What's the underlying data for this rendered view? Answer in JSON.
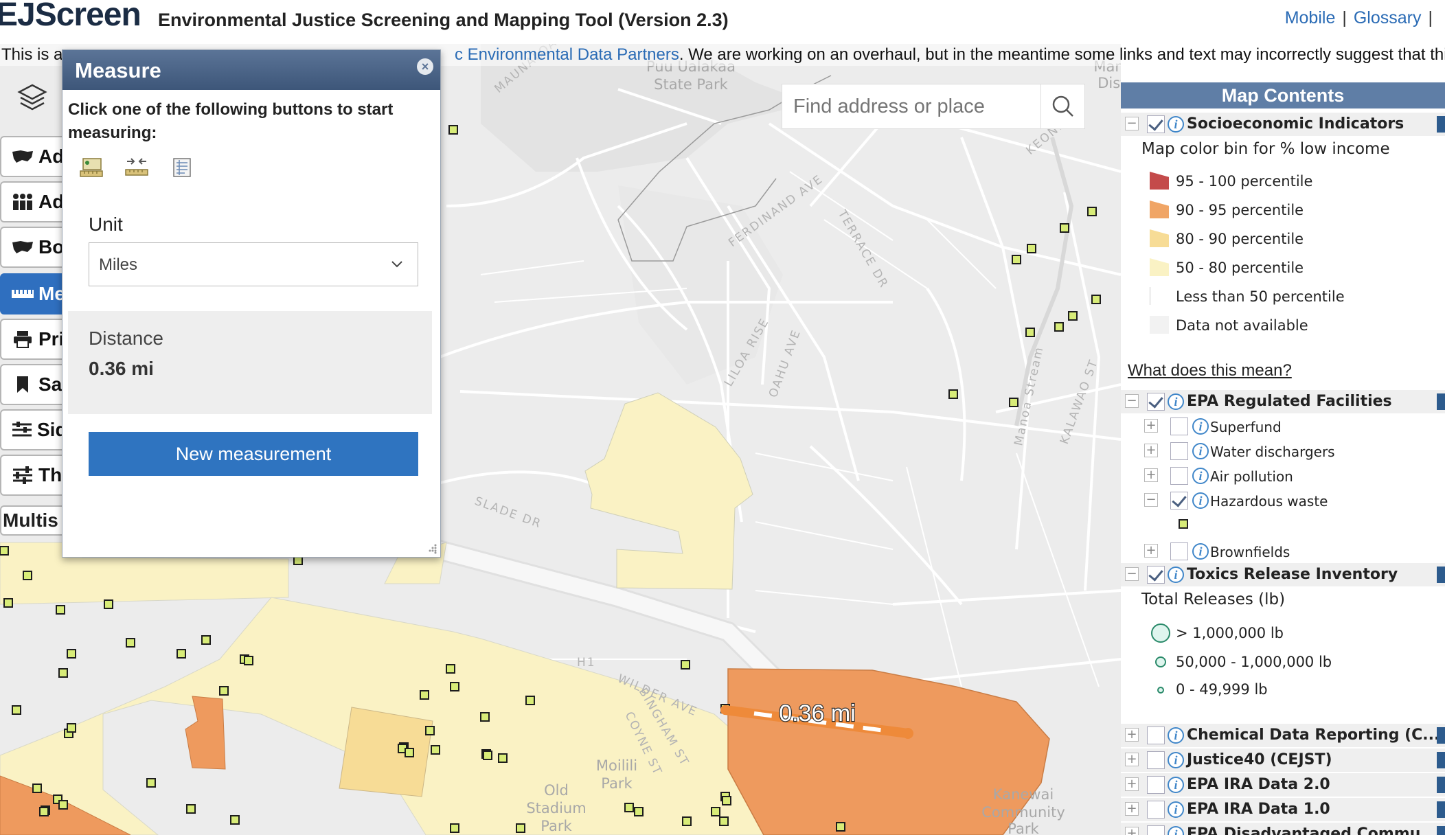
{
  "header": {
    "logo": "EJScreen",
    "title": "Environmental Justice Screening and Mapping Tool (Version 2.3)",
    "links": [
      "Mobile",
      "Glossary"
    ]
  },
  "banner": {
    "lead": "This is a",
    "link": "c Environmental Data Partners",
    "rest": ". We are working on an overhaul, but in the meantime some links and text may incorrectly suggest that this"
  },
  "search": {
    "placeholder": "Find address or place"
  },
  "toolbar": {
    "items": [
      "Ad",
      "Ad",
      "Bo",
      "Me",
      "Pri",
      "Sa",
      "Sid",
      "Th"
    ],
    "multi": "Multis"
  },
  "measure": {
    "title": "Measure",
    "close": "×",
    "instruction": "Click one of the following buttons to start measuring:",
    "tools": [
      "area-tool-icon",
      "distance-tool-icon",
      "location-tool-icon"
    ],
    "unit_label": "Unit",
    "unit_value": "Miles",
    "distance_label": "Distance",
    "distance_value": "0.36 mi",
    "new_button": "New measurement"
  },
  "map": {
    "measure_label": "0.36 mi",
    "road_labels": [
      "MAUNALOA",
      "KEONI",
      "FERDINAND AVE",
      "TERRACE DR",
      "LILOA RISE",
      "OAHU AVE",
      "SLADE DR",
      "Manoa Stream",
      "KALAWAO ST",
      "WILDER AVE",
      "BINGHAM ST",
      "COYNE ST",
      "H1"
    ],
    "place_labels": [
      "Puu Ualakaa",
      "State Park",
      "Manoa Valley",
      "District Park",
      "Moilili",
      "Park",
      "Old",
      "Stadium",
      "Park",
      "Kanewai",
      "Community",
      "Park"
    ]
  },
  "map_contents": {
    "title": "Map Contents",
    "socio": {
      "label": "Socioeconomic Indicators",
      "caption": "Map color bin for % low income",
      "bins": [
        {
          "label": "95 - 100 percentile",
          "color": "#c44b4b"
        },
        {
          "label": "90 - 95 percentile",
          "color": "#f0a566"
        },
        {
          "label": "80 - 90 percentile",
          "color": "#f7dc96"
        },
        {
          "label": "50 - 80 percentile",
          "color": "#faf2c4"
        },
        {
          "label": "Less than 50 percentile",
          "color": "#ffffff"
        },
        {
          "label": "Data not available",
          "color": "#f2f2f2"
        }
      ],
      "what": "What does this mean?"
    },
    "epa": {
      "label": "EPA Regulated Facilities",
      "items": [
        "Superfund",
        "Water dischargers",
        "Air pollution",
        "Hazardous waste",
        "Brownfields"
      ]
    },
    "tri": {
      "label": "Toxics Release Inventory",
      "caption": "Total Releases (lb)",
      "bins": [
        "> 1,000,000 lb",
        "50,000 - 1,000,000 lb",
        "0 - 49,999 lb"
      ]
    },
    "others": [
      "Chemical Data Reporting (C...",
      "Justice40 (CEJST)",
      "EPA IRA Data 2.0",
      "EPA IRA Data 1.0",
      "EPA Disadvantaged Commu..."
    ]
  },
  "colors": {
    "accent": "#2f74c0",
    "panel_header": "#4a6285",
    "high_income": "#ee9a5e",
    "yellow_light": "#faf2c4",
    "facility": "#c8e64a"
  }
}
